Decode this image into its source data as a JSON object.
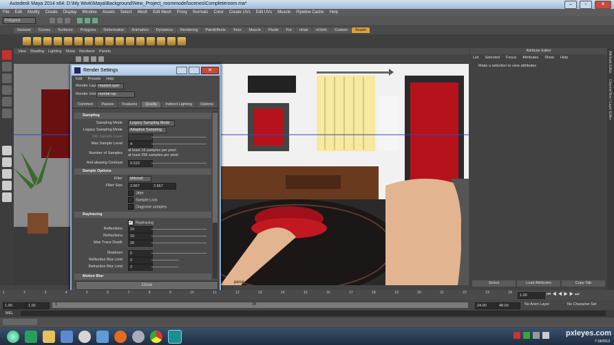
{
  "window": {
    "title": "Autodesk Maya 2014 x64: D:\\My Work\\Maya\\Background\\New_Project_roommodel\\scenes\\Completeroom.ma*"
  },
  "menubar": [
    "File",
    "Edit",
    "Modify",
    "Create",
    "Display",
    "Window",
    "Assets",
    "Select",
    "Mesh",
    "Edit Mesh",
    "Proxy",
    "Normals",
    "Color",
    "Create UVs",
    "Edit UVs",
    "Muscle",
    "Pipeline Cache",
    "Help"
  ],
  "status": {
    "mode": "Polygons"
  },
  "shelf_tabs": [
    "General",
    "Curves",
    "Surfaces",
    "Polygons",
    "Deformation",
    "Animation",
    "Dynamics",
    "Rendering",
    "PaintEffects",
    "Toon",
    "Muscle",
    "Fluids",
    "Fur",
    "nHair",
    "nCloth",
    "Custom",
    "Sourin"
  ],
  "shelf_active": "Sourin",
  "panel_menu": [
    "View",
    "Shading",
    "Lighting",
    "Show",
    "Renderer",
    "Panels"
  ],
  "viewport": {
    "camera_label": "persp"
  },
  "attribute_editor": {
    "title": "Attribute Editor",
    "menu": [
      "List",
      "Selected",
      "Focus",
      "Attributes",
      "Show",
      "Help"
    ],
    "hint": "Make a selection to view attributes",
    "buttons": [
      "Select",
      "Load Attributes",
      "Copy Tab"
    ],
    "side_tabs": [
      "Attribute Editor",
      "Channel Box / Layer Editor"
    ]
  },
  "render_settings": {
    "title": "Render Settings",
    "menu": [
      "Edit",
      "Presets",
      "Help"
    ],
    "render_layer_label": "Render Layer",
    "render_layer_value": "masterLayer",
    "render_using_label": "Render Using",
    "render_using_value": "mental ray",
    "tabs": [
      "Common",
      "Passes",
      "Features",
      "Quality",
      "Indirect Lighting",
      "Options"
    ],
    "active_tab": "Quality",
    "sampling": {
      "header": "Sampling",
      "sampling_mode_label": "Sampling Mode",
      "sampling_mode_value": "Legacy Sampling Mode",
      "legacy_mode_label": "Legacy Sampling Mode",
      "legacy_mode_value": "Adaptive Sampling",
      "min_label": "Min Sample Level",
      "max_label": "Max Sample Level",
      "max_value": "4",
      "num_samples_label": "Number of Samples",
      "num_samples_line1": "at least 16 samples per pixel",
      "num_samples_line2": "at least 256 samples per pixel",
      "aa_label": "Anti-aliasing Contrast",
      "aa_value": "0.010"
    },
    "sample_options": {
      "header": "Sample Options",
      "filter_label": "Filter",
      "filter_value": "Mitchell",
      "filter_size_label": "Filter Size",
      "filter_size_x": "2.667",
      "filter_size_y": "2.667",
      "jitter": "Jitter",
      "sample_lock": "Sample Lock",
      "diagnose": "Diagnose samples"
    },
    "raytracing": {
      "header": "Raytracing",
      "raytracing_label": "Raytracing",
      "reflections_label": "Reflections",
      "reflections_value": "10",
      "refractions_label": "Refractions",
      "refractions_value": "10",
      "max_depth_label": "Max Trace Depth",
      "max_depth_value": "20",
      "shadows_label": "Shadows",
      "shadows_value": "5",
      "refl_blur_label": "Reflection Blur Limit",
      "refl_blur_value": "2",
      "refr_blur_label": "Refraction Blur Limit",
      "refr_blur_value": "2"
    },
    "motion_blur_header": "Motion Blur",
    "close_label": "Close"
  },
  "timeline": {
    "ticks": [
      "1",
      "2",
      "3",
      "4",
      "5",
      "6",
      "7",
      "8",
      "9",
      "10",
      "11",
      "12",
      "13",
      "14",
      "15",
      "16",
      "17",
      "18",
      "19",
      "20",
      "21",
      "22",
      "23",
      "24"
    ],
    "current_frame": "1.00"
  },
  "range": {
    "start": "1.00",
    "inner_start": "1.00",
    "slider_start": "1",
    "slider_end": "24",
    "inner_end": "24.00",
    "end": "48.00",
    "anim_layer": "No Anim Layer",
    "char_set": "No Character Set"
  },
  "cmd_label": "MEL",
  "taskbar": {
    "time": "7:18/2013"
  },
  "watermark": "pxleyes.com"
}
